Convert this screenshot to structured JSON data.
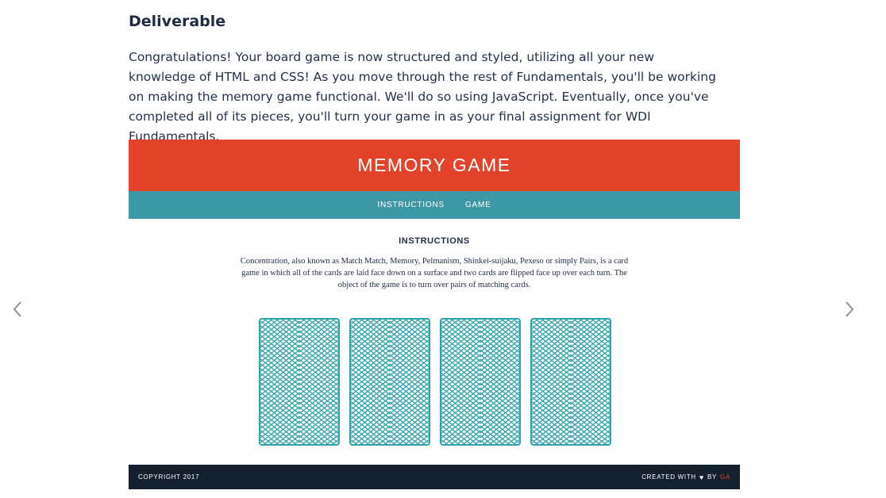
{
  "page": {
    "heading": "Deliverable",
    "paragraph": "Congratulations! Your board game is now structured and styled, utilizing all your new knowledge of HTML and CSS! As you move through the rest of Fundamentals, you'll be working on making the memory game functional. We'll do so using JavaScript. Eventually, once you've completed all of its pieces, you'll turn your game in as your final assignment for WDI Fundamentals."
  },
  "memory_game": {
    "title": "MEMORY GAME",
    "nav": [
      "INSTRUCTIONS",
      "GAME"
    ],
    "section_title": "INSTRUCTIONS",
    "instructions": "Concentration, also known as Match Match, Memory, Pelmanism, Shinkei-suijaku, Pexeso or simply Pairs, is a card game in which all of the cards are laid face down on a surface and two cards are flipped face up over each turn. The object of the game is to turn over pairs of matching cards.",
    "card_count": 4,
    "footer_left": "COPYRIGHT 2017",
    "footer_right_prefix": "CREATED WITH",
    "footer_heart": "♥",
    "footer_by": "BY",
    "footer_brand": "GA"
  },
  "icons": {
    "prev": "chevron-left-icon",
    "next": "chevron-right-icon",
    "heart": "heart-icon"
  },
  "colors": {
    "header_red": "#e2432a",
    "nav_teal": "#3d98a6",
    "card_teal": "#2fa3ac",
    "footer_navy": "#13212f",
    "arrow_gray": "#8a8f99"
  }
}
